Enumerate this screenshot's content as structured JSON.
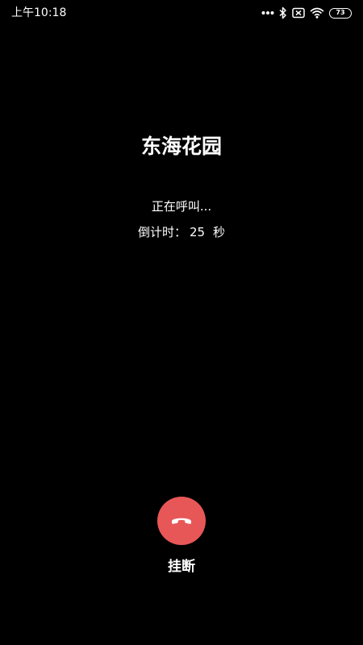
{
  "status_bar": {
    "time": "上午10:18",
    "icons": [
      "more-dots-icon",
      "bluetooth-icon",
      "sim-off-icon",
      "wifi-icon",
      "battery-icon"
    ],
    "battery_level": "73"
  },
  "call": {
    "contact_name": "东海花园",
    "status_text": "正在呼叫...",
    "countdown_label": "倒计时：",
    "countdown_value": "25",
    "countdown_unit": "秒"
  },
  "actions": {
    "hangup_label": "挂断",
    "hangup_color": "#e85757",
    "hangup_icon": "phone-hangup-icon"
  }
}
